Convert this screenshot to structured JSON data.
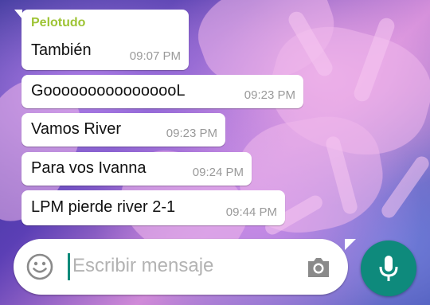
{
  "chat": {
    "messages": [
      {
        "sender": "Pelotudo",
        "text": "También",
        "time": "09:07 PM"
      },
      {
        "text": "GoooooooooooooooL",
        "time": "09:23 PM"
      },
      {
        "text": "Vamos River",
        "time": "09:23 PM"
      },
      {
        "text": "Para vos Ivanna",
        "time": "09:24 PM"
      },
      {
        "text": "LPM pierde river 2-1",
        "time": "09:44 PM"
      }
    ]
  },
  "composer": {
    "placeholder": "Escribir mensaje",
    "emoji_icon": "emoji-icon",
    "camera_icon": "camera-icon",
    "mic_icon": "mic-icon"
  },
  "colors": {
    "sender_name": "#9ec435",
    "accent": "#0e8a7c",
    "time_text": "#9a9a9a"
  }
}
